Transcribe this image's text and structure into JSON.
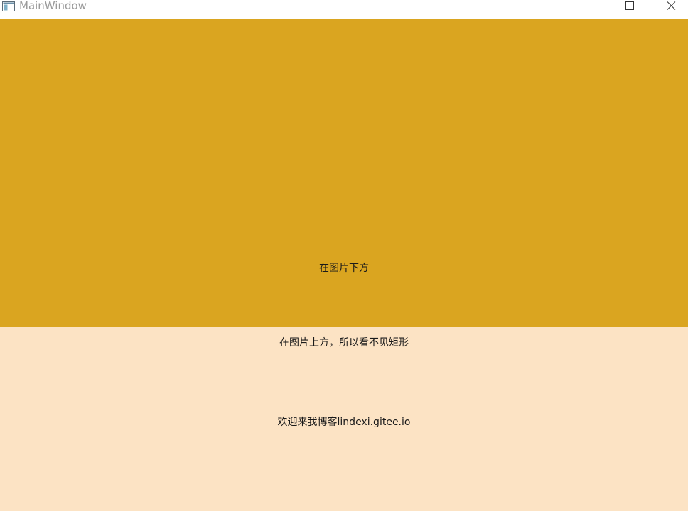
{
  "window": {
    "title": "MainWindow",
    "icon": "app-window-icon",
    "controls": {
      "minimize_icon": "minimize-icon",
      "maximize_icon": "maximize-icon",
      "close_icon": "close-icon"
    }
  },
  "colors": {
    "image_fill": "#DAA520",
    "background": "#FCE3C4",
    "titlebar": "#FFFFFF"
  },
  "content": {
    "text_below_image": "在图片下方",
    "text_above_image": "在图片上方，所以看不见矩形",
    "blog_text": "欢迎来我博客lindexi.gitee.io"
  }
}
